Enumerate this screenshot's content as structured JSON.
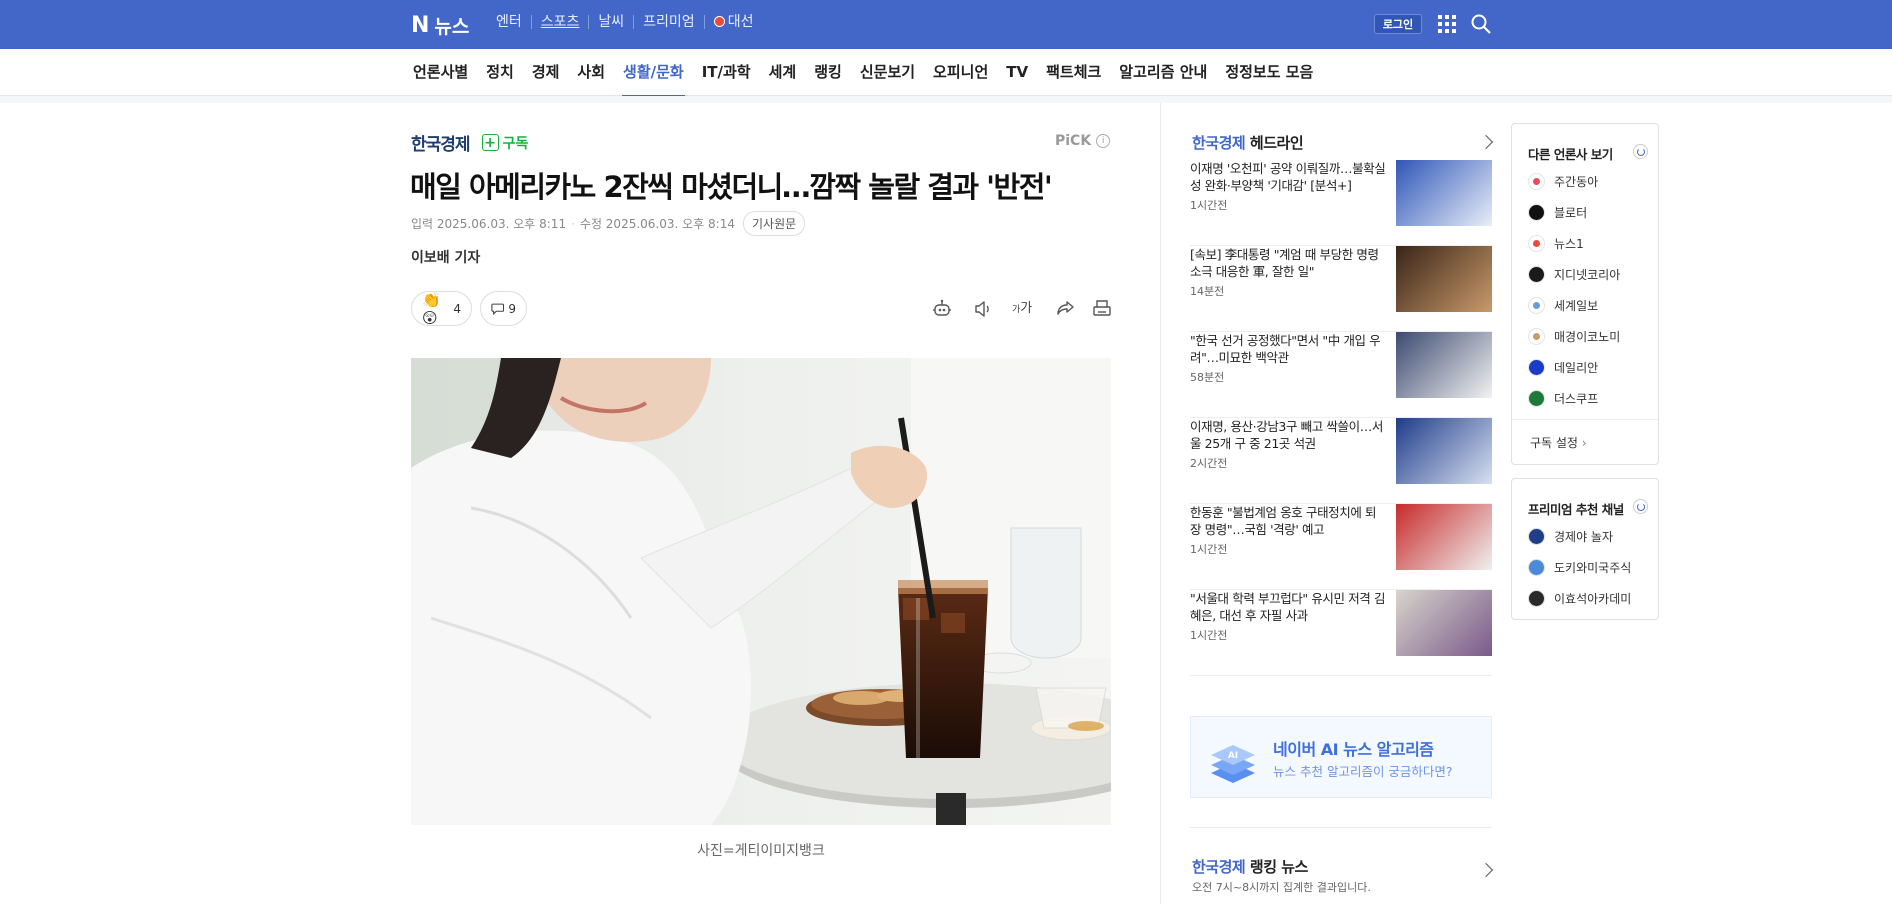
{
  "header": {
    "logo_n": "N",
    "logo_text": "뉴스",
    "services": [
      "엔터",
      "스포츠",
      "날씨",
      "프리미엄",
      "대선"
    ],
    "login_label": "로그인"
  },
  "nav": {
    "items": [
      "언론사별",
      "정치",
      "경제",
      "사회",
      "생활/문화",
      "IT/과학",
      "세계",
      "랭킹",
      "신문보기",
      "오피니언",
      "TV",
      "팩트체크",
      "알고리즘 안내",
      "정정보도 모음"
    ],
    "active": "생활/문화"
  },
  "article": {
    "press": "한국경제",
    "subscribe_label": "구독",
    "pick_label": "PiCK",
    "headline": "매일 아메리카노 2잔씩 마셨더니…깜짝 놀랄 결과 '반전'",
    "input_date": "입력 2025.06.03. 오후 8:11",
    "modified_date": "수정 2025.06.03. 오후 8:14",
    "original_label": "기사원문",
    "reporter": "이보배 기자",
    "reaction_count": "4",
    "comment_count": "9",
    "font_size_label": "가가",
    "caption": "사진=게티이미지뱅크"
  },
  "headlines": {
    "brand": "한국경제",
    "suffix": " 헤드라인",
    "items": [
      {
        "title": "이재명 '오천피' 공약 이뤄질까…불확실성 완화·부양책 '기대감' [분석+]",
        "time": "1시간전"
      },
      {
        "title": "[속보] 李대통령 \"계엄 때 부당한 명령 소극 대응한 軍, 잘한 일\"",
        "time": "14분전"
      },
      {
        "title": "\"한국 선거 공정했다\"면서 \"中 개입 우려\"…미묘한 백악관",
        "time": "58분전"
      },
      {
        "title": "이재명, 용산·강남3구 빼고 싹쓸이…서울 25개 구 중 21곳 석권",
        "time": "2시간전"
      },
      {
        "title": "한동훈 \"불법계엄 옹호 구태정치에 퇴장 명령\"…국힘 '격랑' 예고",
        "time": "1시간전"
      },
      {
        "title": "\"서울대 학력 부끄럽다\" 유시민 저격 김혜은, 대선 후 자필 사과",
        "time": "1시간전"
      }
    ]
  },
  "ai_box": {
    "icon_text": "AI",
    "title": "네이버 AI 뉴스 알고리즘",
    "subtitle": "뉴스 추천 알고리즘이 궁금하다면?"
  },
  "ranking": {
    "brand": "한국경제",
    "suffix": " 랭킹 뉴스",
    "subtitle": "오전 7시~8시까지 집계한 결과입니다."
  },
  "other_press": {
    "title": "다른 언론사 보기",
    "items": [
      "주간동아",
      "블로터",
      "뉴스1",
      "지디넷코리아",
      "세계일보",
      "매경이코노미",
      "데일리안",
      "더스쿠프"
    ],
    "footer": "구독 설정"
  },
  "premium": {
    "title": "프리미엄 추천 채널",
    "items": [
      "경제야 놀자",
      "도키와미국주식",
      "이효석아카데미"
    ]
  }
}
